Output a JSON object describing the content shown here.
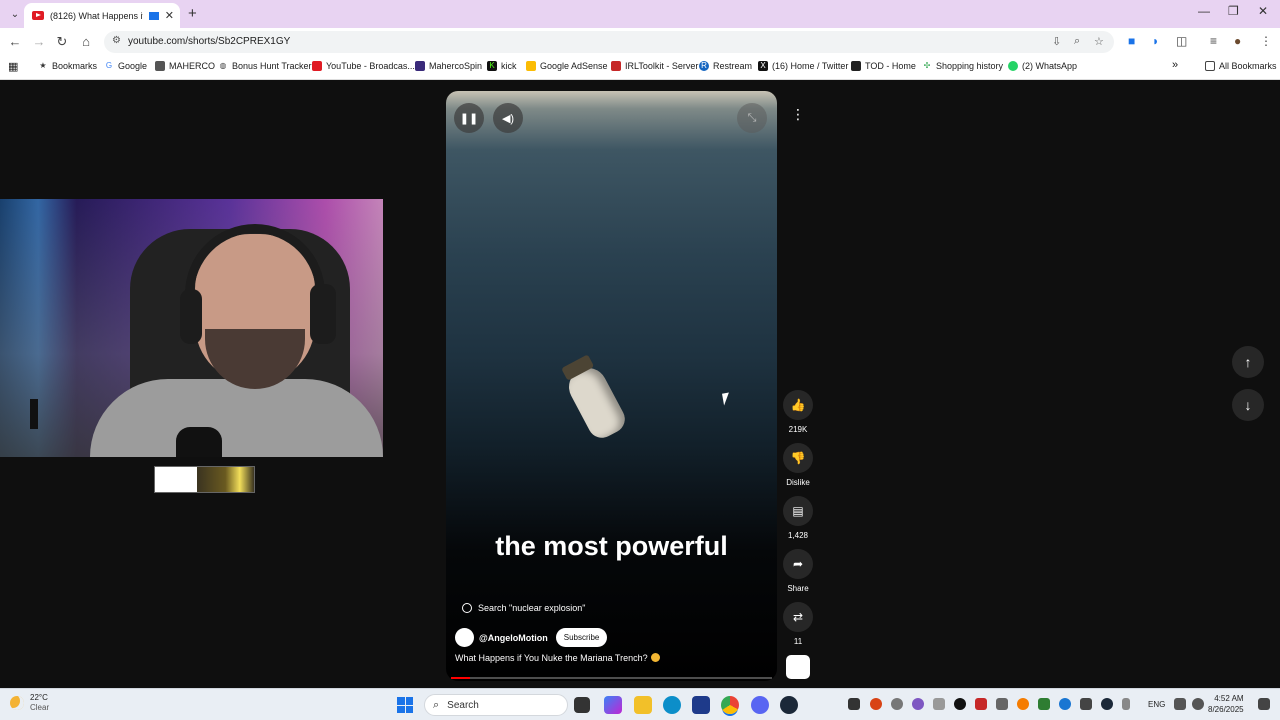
{
  "browser": {
    "tab_title": "(8126) What Happens if Yo...",
    "url": "youtube.com/shorts/Sb2CPREX1GY",
    "new_tab_glyph": "+",
    "close_glyph": "✕"
  },
  "bookmarks": {
    "items": [
      {
        "label": "Bookmarks",
        "color": "#333333"
      },
      {
        "label": "Google",
        "color": "#4285f4"
      },
      {
        "label": "MAHERCO",
        "color": "#555555"
      },
      {
        "label": "Bonus Hunt Tracker",
        "color": "#444444"
      },
      {
        "label": "YouTube - Broadcas...",
        "color": "#e01b24"
      },
      {
        "label": "MahercoSpin",
        "color": "#3a2a7a"
      },
      {
        "label": "kick",
        "color": "#53fc18"
      },
      {
        "label": "Google AdSense",
        "color": "#fbbc04"
      },
      {
        "label": "IRLToolkit - Server",
        "color": "#c62828"
      },
      {
        "label": "Restream",
        "color": "#1565c0"
      },
      {
        "label": "(16) Home / Twitter",
        "color": "#111111"
      },
      {
        "label": "TOD - Home",
        "color": "#222222"
      },
      {
        "label": "Shopping history",
        "color": "#34a853"
      },
      {
        "label": "(2) WhatsApp",
        "color": "#25d366"
      }
    ],
    "all_bookmarks": "All Bookmarks"
  },
  "short": {
    "caption": "the most powerful",
    "search_suggestion": "Search \"nuclear explosion\"",
    "channel": "@AngeloMotion",
    "subscribe_label": "Subscribe",
    "title": "What Happens if You Nuke the Mariana Trench?",
    "progress": 0.06
  },
  "actions": {
    "likes": "219K",
    "dislike_label": "Dislike",
    "comments": "1,428",
    "share_label": "Share",
    "remix_count": "11"
  },
  "taskbar": {
    "temp": "22°C",
    "condition": "Clear",
    "search_placeholder": "Search",
    "lang": "ENG",
    "time": "4:52 AM",
    "date": "8/26/2025"
  },
  "colors": {
    "accent": "#1a73e8",
    "youtube_red": "#ff0000",
    "tabstrip": "#e8d3f2"
  }
}
